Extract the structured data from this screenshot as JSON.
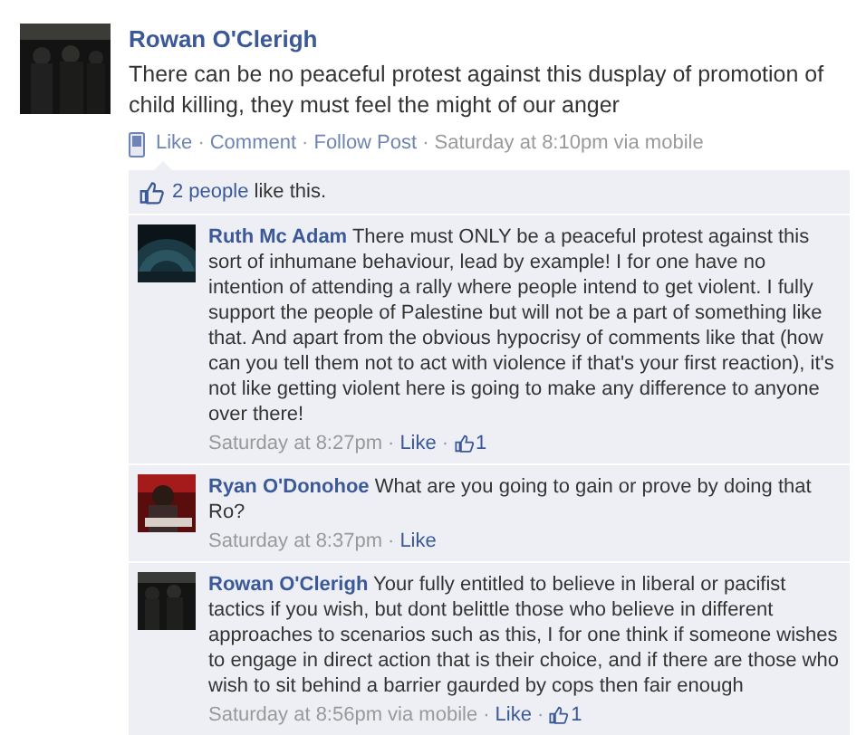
{
  "separator": "·",
  "post": {
    "author": "Rowan O'Clerigh",
    "text": "There can be no peaceful protest against this dusplay of promotion of child killing, they must feel the might of our anger",
    "actions": [
      "Like",
      "Comment",
      "Follow Post"
    ],
    "time": "Saturday at 8:10pm via mobile"
  },
  "likes": {
    "link": "2 people",
    "text": "like this."
  },
  "comments": [
    {
      "author": "Ruth Mc Adam",
      "text": "There must ONLY be a peaceful protest against this sort of inhumane behaviour, lead by example! I for one have no intention of attending a rally where people intend to get violent. I fully support the people of Palestine but will not be a part of something like that. And apart from the obvious hypocrisy of comments like that (how can you tell them not to act with violence if that's your first reaction), it's not like getting violent here is going to make any difference to anyone over there!",
      "time": "Saturday at 8:27pm",
      "like": "Like",
      "like_count": "1"
    },
    {
      "author": "Ryan O'Donohoe",
      "text": "What are you going to gain or prove by doing that Ro?",
      "time": "Saturday at 8:37pm",
      "like": "Like"
    },
    {
      "author": "Rowan O'Clerigh",
      "text": "Your fully entitled to believe in liberal or pacifist tactics if you wish, but dont belittle those who believe in different approaches to scenarios such as this, I for one think if someone wishes to engage in direct action that is their choice, and if there are those who wish to sit behind a barrier gaurded by cops then fair enough",
      "time": "Saturday at 8:56pm via mobile",
      "like": "Like",
      "like_count": "1"
    }
  ]
}
